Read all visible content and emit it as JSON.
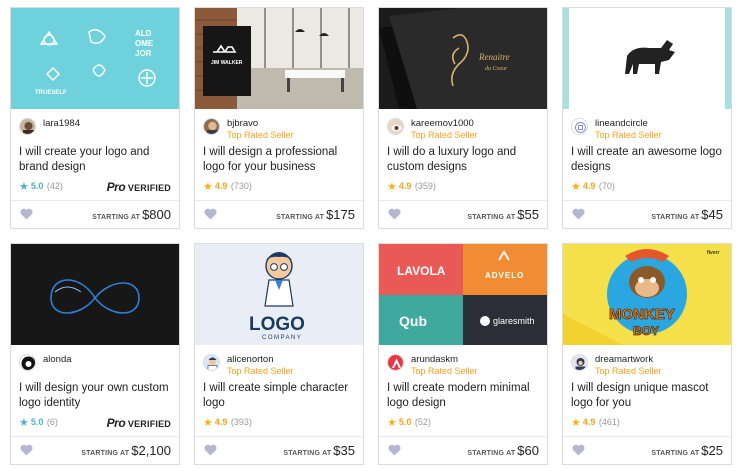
{
  "labels": {
    "starting_at": "STARTING AT",
    "pro": "Pro",
    "verified": "VERIFIED"
  },
  "gigs": [
    {
      "seller": "lara1984",
      "level": "",
      "title": "I will create your logo and brand design",
      "rating": "5.0",
      "count": "(42)",
      "price": "$800",
      "pro": true,
      "star_color": "blue",
      "thumb_texts": [
        "ALD",
        "OME",
        "JOR",
        "TRUESELF"
      ]
    },
    {
      "seller": "bjbravo",
      "level": "Top Rated Seller",
      "title": "I will design a professional logo for your business",
      "rating": "4.9",
      "count": "(730)",
      "price": "$175",
      "pro": false,
      "star_color": "gold",
      "thumb_texts": [
        "JIM WALKER"
      ]
    },
    {
      "seller": "kareemov1000",
      "level": "Top Rated Seller",
      "title": "I will do a luxury logo and custom designs",
      "rating": "4.9",
      "count": "(359)",
      "price": "$55",
      "pro": false,
      "star_color": "gold",
      "thumb_texts": [
        "Renaitre",
        "du Coeur"
      ]
    },
    {
      "seller": "lineandcircle",
      "level": "Top Rated Seller",
      "title": "I will create an awesome logo designs",
      "rating": "4.9",
      "count": "(70)",
      "price": "$45",
      "pro": false,
      "star_color": "gold",
      "thumb_texts": []
    },
    {
      "seller": "alonda",
      "level": "",
      "title": "I will design your own custom logo identity",
      "rating": "5.0",
      "count": "(6)",
      "price": "$2,100",
      "pro": true,
      "star_color": "blue",
      "thumb_texts": []
    },
    {
      "seller": "alicenorton",
      "level": "Top Rated Seller",
      "title": "I will create simple character logo",
      "rating": "4.9",
      "count": "(393)",
      "price": "$35",
      "pro": false,
      "star_color": "gold",
      "thumb_texts": [
        "LOGO",
        "COMPANY"
      ]
    },
    {
      "seller": "arundaskm",
      "level": "Top Rated Seller",
      "title": "I will create modern minimal logo design",
      "rating": "5.0",
      "count": "(52)",
      "price": "$60",
      "pro": false,
      "star_color": "gold",
      "thumb_texts": [
        "LAVOLA",
        "ADVELO",
        "Qub",
        "glaresmith"
      ]
    },
    {
      "seller": "dreamartwork",
      "level": "Top Rated Seller",
      "title": "I will design unique mascot logo for you",
      "rating": "4.9",
      "count": "(461)",
      "price": "$25",
      "pro": false,
      "star_color": "gold",
      "thumb_texts": [
        "MONKEY",
        "BOY",
        "fiverr"
      ]
    }
  ],
  "colors": {
    "top_rated": "#f7a21b",
    "star_gold": "#f7b21b",
    "star_blue": "#4fb0c6",
    "heart": "#b5b6cf"
  },
  "icons": {
    "heart": "heart-icon",
    "star": "star-icon"
  }
}
